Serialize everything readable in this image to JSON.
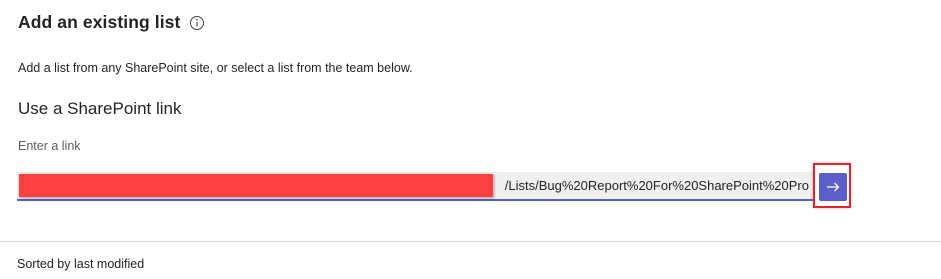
{
  "header": {
    "title": "Add an existing list",
    "info_icon": "info-icon"
  },
  "description": "Add a list from any SharePoint site, or select a list from the team below.",
  "link_section": {
    "heading": "Use a SharePoint link",
    "field_label": "Enter a link",
    "input_value": "/Lists/Bug%20Report%20For%20SharePoint%20Pro",
    "submit_icon": "arrow-right-icon"
  },
  "footer": {
    "sort_label": "Sorted by last modified"
  },
  "colors": {
    "accent": "#5b5fc7",
    "redaction": "#ff4040",
    "highlight": "#e7222c"
  }
}
